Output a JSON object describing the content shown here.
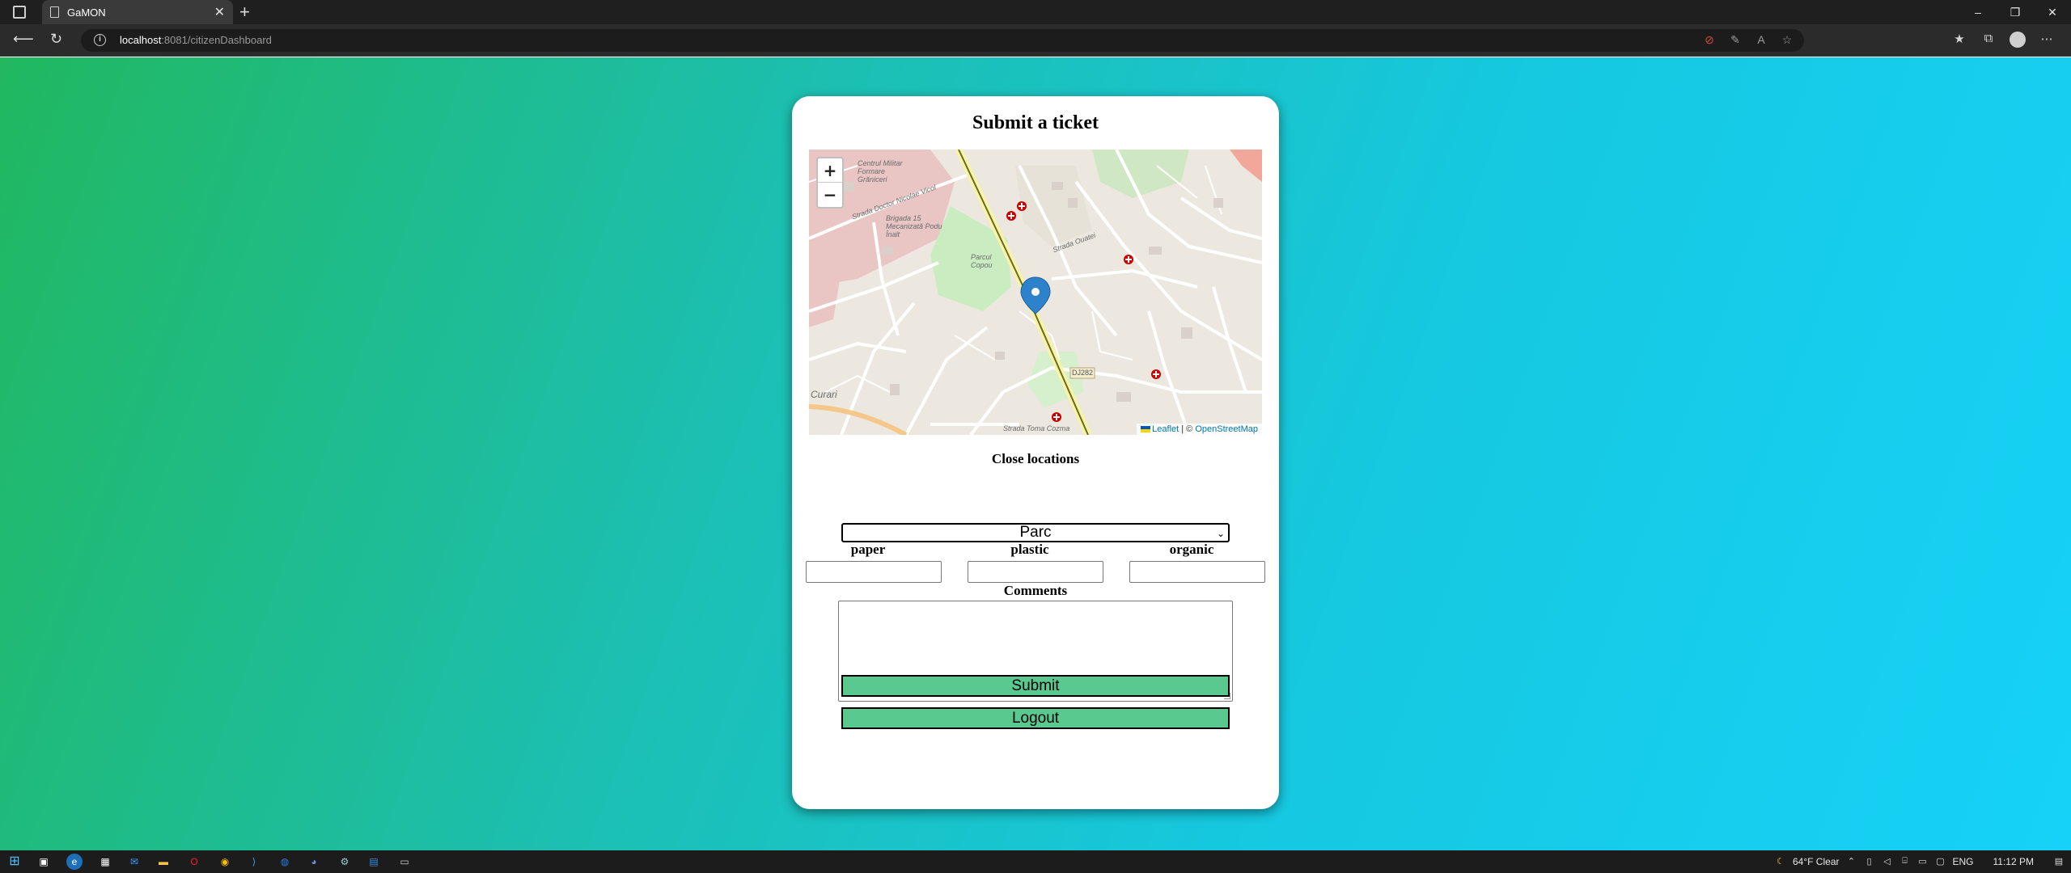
{
  "browser": {
    "tab_title": "GaMON",
    "tab_close": "✕",
    "new_tab": "+",
    "url_host": "localhost",
    "url_rest": ":8081/citizenDashboard",
    "window_controls": [
      "–",
      "❐",
      "✕"
    ]
  },
  "card": {
    "title": "Submit a ticket",
    "close_locations_label": "Close locations",
    "selected_location": "Parc",
    "quantity_labels": [
      "paper",
      "plastic",
      "organic"
    ],
    "quantity_values": [
      "",
      "",
      ""
    ],
    "comments_label": "Comments",
    "comments_value": "",
    "submit_label": "Submit",
    "logout_label": "Logout"
  },
  "map": {
    "zoom_in": "+",
    "zoom_out": "−",
    "attribution_leaflet": "Leaflet",
    "attribution_sep": " | © ",
    "attribution_osm": "OpenStreetMap",
    "labels": [
      "Centrul Militar Formare Grăniceri",
      "Strada Doctor Nicolae Vicol",
      "Brigada 15 Mecanizată Podu Înalt",
      "Parcul Copou",
      "Strada Ouatei",
      "Strada Toma Cozma",
      "DJ282",
      "Curari"
    ]
  },
  "taskbar": {
    "weather": "64°F  Clear",
    "language": "ENG",
    "time": "11:12 PM"
  },
  "colors": {
    "gradient_start": "#21b860",
    "gradient_end": "#16d2f8",
    "button_green": "#5ac98f"
  }
}
